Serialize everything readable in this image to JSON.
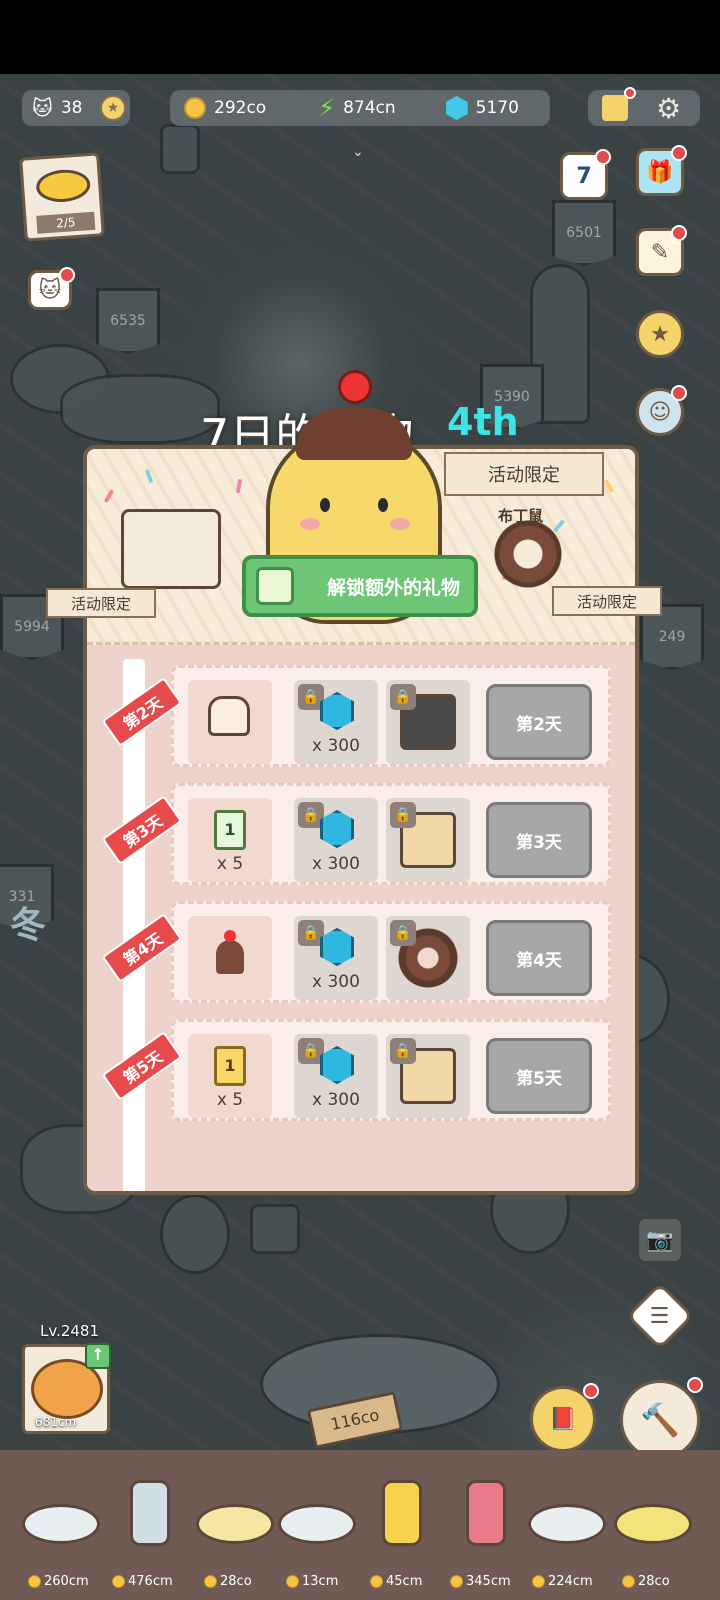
{
  "hud": {
    "cats": "38",
    "coins": "292co",
    "energy": "874cn",
    "gems": "5170"
  },
  "recipe_card": {
    "progress": "2/5"
  },
  "calendar_day": "7",
  "signs": [
    "6535",
    "6501",
    "5390",
    "5994",
    "249",
    "331"
  ],
  "event": {
    "title": "7日的礼物",
    "day_badge": "4th",
    "tag_top": "活动限定",
    "mascot_name": "布丁鼠",
    "tag_left": "活动限定",
    "tag_right": "活动限定",
    "unlock_label": "解锁额外的礼物"
  },
  "days": [
    {
      "ribbon": "第2天",
      "free_qty": "",
      "gem_qty": "x 300",
      "button": "第2天"
    },
    {
      "ribbon": "第3天",
      "free_qty": "x 5",
      "gem_qty": "x 300",
      "button": "第3天"
    },
    {
      "ribbon": "第4天",
      "free_qty": "",
      "gem_qty": "x 300",
      "button": "第4天"
    },
    {
      "ribbon": "第5天",
      "free_qty": "x 5",
      "gem_qty": "x 300",
      "button": "第5天"
    }
  ],
  "level": {
    "label": "Lv.2481",
    "price": "681cm"
  },
  "tip_sign": "116co",
  "winter_char": "冬",
  "dock": [
    {
      "price": "260cm"
    },
    {
      "price": "476cm"
    },
    {
      "price": "28co"
    },
    {
      "price": "13cm"
    },
    {
      "price": "45cm"
    },
    {
      "price": "345cm"
    },
    {
      "price": "224cm"
    },
    {
      "price": "28co"
    }
  ],
  "colors": {
    "accent_green": "#6dc676",
    "ribbon_red": "#e64a4a",
    "gem_cyan": "#43c7e8",
    "badge_cyan": "#3ee3e6"
  }
}
